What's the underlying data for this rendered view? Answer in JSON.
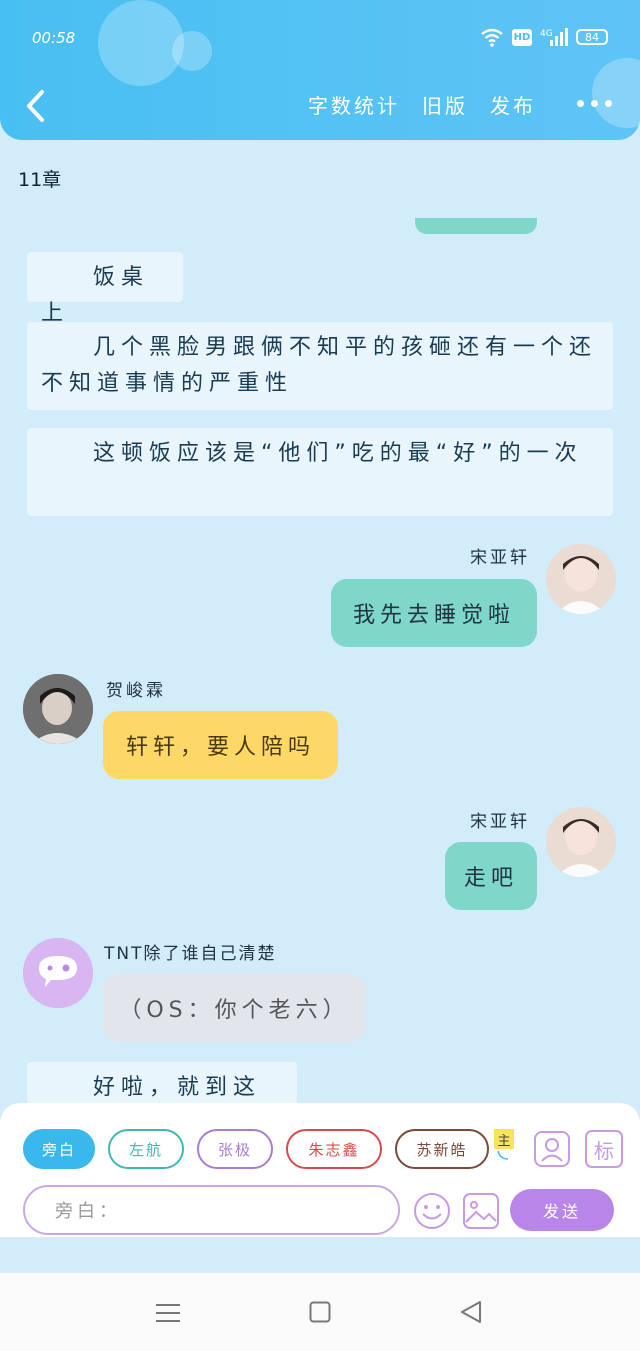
{
  "status_bar": {
    "time": "00:58",
    "hd": "HD",
    "network": "4G",
    "battery": "84"
  },
  "header": {
    "links": [
      "字数统计",
      "旧版",
      "发布"
    ]
  },
  "chapter": {
    "title": "11章"
  },
  "narration": [
    "饭桌上",
    "几个黑脸男跟俩不知平的孩砸还有一个还不知道事情的严重性",
    "这顿饭应该是“他们”吃的最“好”的一次",
    "好啦，就到这里"
  ],
  "messages": [
    {
      "name": "宋亚轩",
      "text": "我先去睡觉啦"
    },
    {
      "name": "贺峻霖",
      "text": "轩轩，要人陪吗"
    },
    {
      "name": "宋亚轩",
      "text": "走吧"
    },
    {
      "name": "TNT除了谁自己清楚",
      "text": "（OS：你个老六）"
    }
  ],
  "roles": [
    {
      "label": "旁白",
      "color": "#3ab8ec",
      "active": true
    },
    {
      "label": "左航",
      "color": "#3cb9b0"
    },
    {
      "label": "张极",
      "color": "#a97cd6"
    },
    {
      "label": "朱志鑫",
      "color": "#d94b4b"
    },
    {
      "label": "苏新皓",
      "color": "#7a4a3a"
    }
  ],
  "tools": {
    "main_tag": "主",
    "mark_label": "标"
  },
  "input": {
    "value": "旁白："
  },
  "send_label": "发送"
}
